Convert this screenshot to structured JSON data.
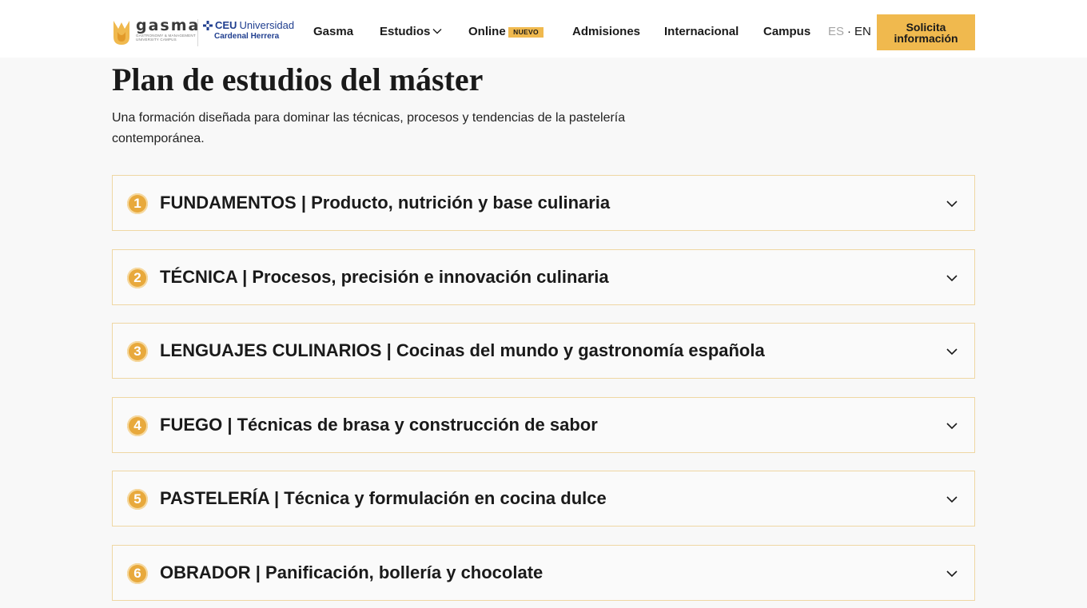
{
  "header": {
    "logo_gasma": {
      "word": "gasma",
      "sub1": "Gastronomy & Management",
      "sub2": "University Campus"
    },
    "logo_ceu": {
      "bold": "CEU",
      "name": "Universidad",
      "sub": "Cardenal Herrera"
    },
    "nav": {
      "gasma": "Gasma",
      "estudios": "Estudios",
      "online": "Online",
      "online_badge": "NUEVO",
      "admisiones": "Admisiones",
      "internacional": "Internacional",
      "campus": "Campus"
    },
    "lang": {
      "es": "ES",
      "sep": "·",
      "en": "EN"
    },
    "cta_line1": "Solicita",
    "cta_line2": "información"
  },
  "main": {
    "title": "Plan de estudios del máster",
    "subtitle": "Una formación diseñada para dominar las técnicas, procesos y tendencias de la pastelería contemporánea.",
    "modules": [
      {
        "num": "1",
        "title": "FUNDAMENTOS | Producto, nutrición y base culinaria"
      },
      {
        "num": "2",
        "title": "TÉCNICA | Procesos, precisión e innovación culinaria"
      },
      {
        "num": "3",
        "title": "LENGUAJES CULINARIOS | Cocinas del mundo y gastronomía española"
      },
      {
        "num": "4",
        "title": "FUEGO | Técnicas de brasa y construcción de sabor"
      },
      {
        "num": "5",
        "title": "PASTELERÍA | Técnica y formulación en cocina dulce"
      },
      {
        "num": "6",
        "title": "OBRADOR | Panificación, bollería y chocolate"
      }
    ]
  },
  "colors": {
    "accent": "#f0b94e",
    "number_badge": "#e8a93c",
    "border": "#efd7a3",
    "brand_ceu": "#1f3e8f"
  },
  "icons": {
    "logo_mark": "gasma-logo-icon",
    "ceu_mark": "ceu-cross-icon",
    "dropdown": "chevron-down-icon",
    "accordion": "chevron-down-icon"
  }
}
